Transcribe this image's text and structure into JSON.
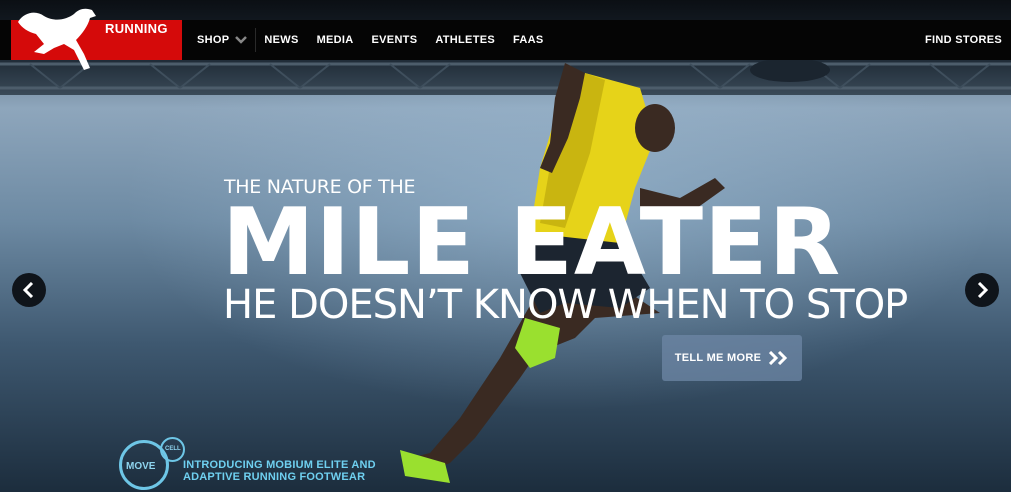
{
  "brand": {
    "section_label": "RUNNING",
    "accent": "#d50a0a"
  },
  "nav": {
    "items": [
      {
        "label": "SHOP",
        "has_dropdown": true
      },
      {
        "label": "NEWS"
      },
      {
        "label": "MEDIA"
      },
      {
        "label": "EVENTS"
      },
      {
        "label": "ATHLETES"
      },
      {
        "label": "FAAS"
      }
    ],
    "find_stores": "FIND STORES"
  },
  "hero": {
    "eyebrow": "THE NATURE OF THE",
    "title": "MILE EATER",
    "subtitle": "HE DOESN’T KNOW WHEN TO STOP",
    "cta_label": "TELL ME MORE"
  },
  "carousel": {
    "prev_icon": "chevron-left-icon",
    "next_icon": "chevron-right-icon"
  },
  "promo": {
    "move_label": "MOVE",
    "cell_label": "CELL",
    "line1": "INTRODUCING MOBIUM ELITE AND",
    "line2": "ADAPTIVE RUNNING FOOTWEAR",
    "color": "#6fd0f0"
  }
}
